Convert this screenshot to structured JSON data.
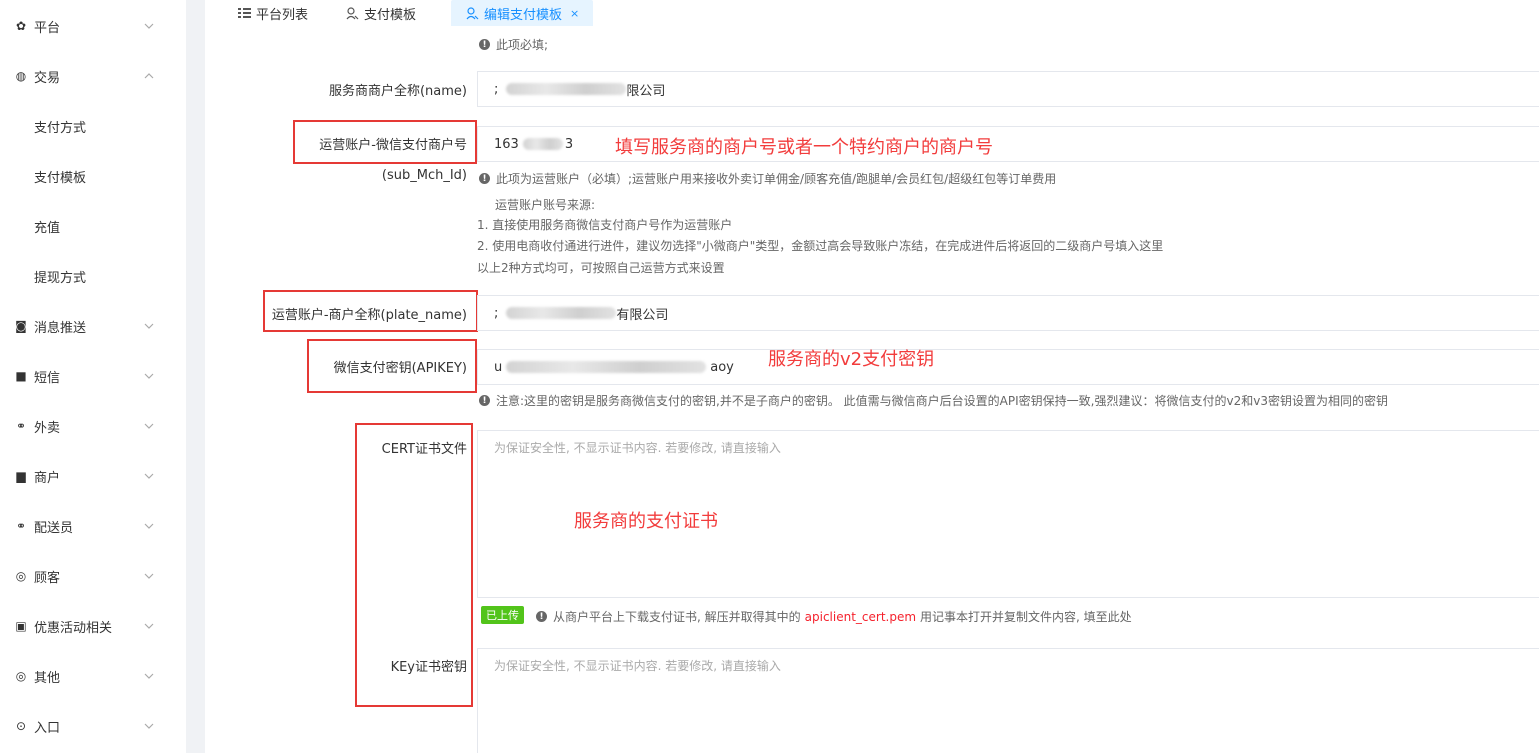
{
  "sidebar": {
    "items": [
      {
        "label": "平台",
        "icon": "gear-icon",
        "glyph": "✿",
        "expanded": false
      },
      {
        "label": "交易",
        "icon": "trade-icon",
        "glyph": "◍",
        "expanded": true,
        "children": [
          "支付方式",
          "支付模板",
          "充值",
          "提现方式"
        ]
      },
      {
        "label": "消息推送",
        "icon": "bell-icon",
        "glyph": "◙",
        "expanded": false
      },
      {
        "label": "短信",
        "icon": "message-icon",
        "glyph": "■",
        "expanded": false
      },
      {
        "label": "外卖",
        "icon": "bike-icon",
        "glyph": "⚭",
        "expanded": false
      },
      {
        "label": "商户",
        "icon": "shop-icon",
        "glyph": "▆",
        "expanded": false
      },
      {
        "label": "配送员",
        "icon": "rider-icon",
        "glyph": "⚭",
        "expanded": false
      },
      {
        "label": "顾客",
        "icon": "user-icon",
        "glyph": "◎",
        "expanded": false
      },
      {
        "label": "优惠活动相关",
        "icon": "gift-icon",
        "glyph": "▣",
        "expanded": false
      },
      {
        "label": "其他",
        "icon": "more-icon",
        "glyph": "◎",
        "expanded": false
      },
      {
        "label": "入口",
        "icon": "entry-icon",
        "glyph": "⊙",
        "expanded": false
      }
    ]
  },
  "tabs": [
    {
      "label": "平台列表",
      "icon": "list-icon",
      "active": false
    },
    {
      "label": "支付模板",
      "icon": "template-icon",
      "active": false
    },
    {
      "label": "编辑支付模板",
      "icon": "template-icon",
      "active": true,
      "close": "×"
    }
  ],
  "form": {
    "top_help": "此项必填;",
    "name": {
      "label": "服务商商户全称(name)",
      "prefix": ";",
      "suffix": "限公司"
    },
    "sub_mch": {
      "label": "运营账户-微信支付商户号",
      "label2": "(sub_Mch_Id)",
      "prefix": "163",
      "suffix": "3",
      "help": "此项为运营账户（必填）;运营账户用来接收外卖订单佣金/顾客充值/跑腿单/会员红包/超级红包等订单费用",
      "notes": [
        "运营账户账号来源:",
        "1. 直接使用服务商微信支付商户号作为运营账户",
        "2. 使用电商收付通进行进件，建议勿选择\"小微商户\"类型，金额过高会导致账户冻结，在完成进件后将返回的二级商户号填入这里",
        "以上2种方式均可，可按照自己运营方式来设置"
      ]
    },
    "plate_name": {
      "label": "运营账户-商户全称(plate_name)",
      "prefix": ";",
      "suffix": "有限公司"
    },
    "apikey": {
      "label": "微信支付密钥(APIKEY)",
      "prefix": "u",
      "suffix": "aoy",
      "help": "注意:这里的密钥是服务商微信支付的密钥,并不是子商户的密钥。 此值需与微信商户后台设置的API密钥保持一致,强烈建议：将微信支付的v2和v3密钥设置为相同的密钥"
    },
    "cert": {
      "label": "CERT证书文件",
      "placeholder": "为保证安全性, 不显示证书内容. 若要修改, 请直接输入",
      "badge": "已上传",
      "help_prefix": "从商户平台上下载支付证书, 解压并取得其中的",
      "help_file": "apiclient_cert.pem",
      "help_suffix": "用记事本打开并复制文件内容, 填至此处"
    },
    "key": {
      "label": "KEy证书密钥",
      "placeholder": "为保证安全性, 不显示证书内容. 若要修改, 请直接输入"
    }
  },
  "annotations": {
    "sub_mch": "填写服务商的商户号或者一个特约商户的商户号",
    "apikey": "服务商的v2支付密钥",
    "cert": "服务商的支付证书"
  },
  "colors": {
    "accent": "#1890ff",
    "annotation": "#f23c3c",
    "badge": "#52c41a"
  }
}
